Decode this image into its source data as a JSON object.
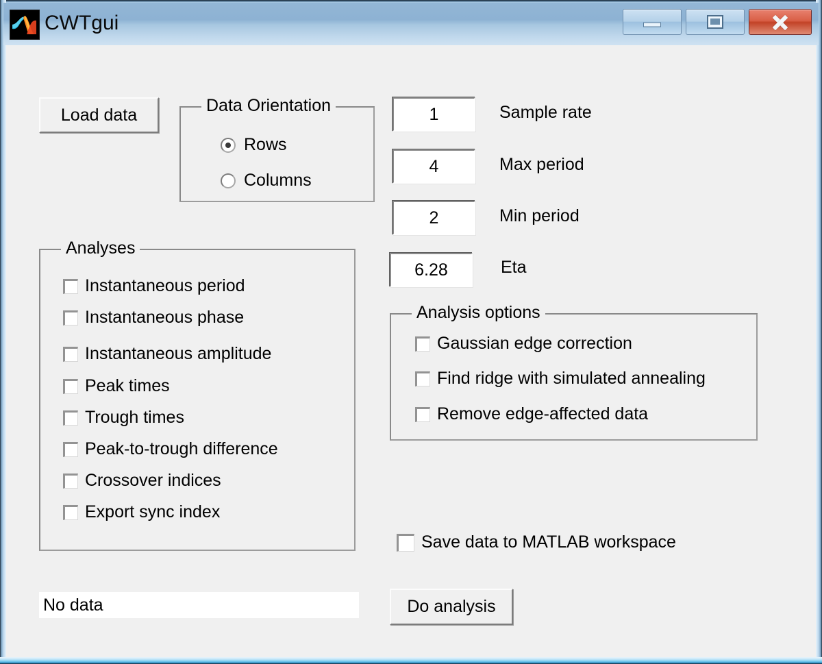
{
  "window": {
    "title": "CWTgui",
    "icon": "matlab-logo-icon",
    "controls": {
      "minimize": "minimize-icon",
      "maximize": "restore-icon",
      "close": "close-icon"
    }
  },
  "toolbar": {
    "load_data_label": "Load data"
  },
  "data_orientation": {
    "title": "Data Orientation",
    "options": [
      {
        "label": "Rows",
        "selected": true
      },
      {
        "label": "Columns",
        "selected": false
      }
    ]
  },
  "parameters": [
    {
      "value": "1",
      "label": "Sample rate"
    },
    {
      "value": "4",
      "label": "Max period"
    },
    {
      "value": "2",
      "label": "Min period"
    },
    {
      "value": "6.28",
      "label": "Eta"
    }
  ],
  "analyses": {
    "title": "Analyses",
    "items": [
      {
        "label": "Instantaneous period",
        "checked": false
      },
      {
        "label": "Instantaneous phase",
        "checked": false
      },
      {
        "label": "Instantaneous amplitude",
        "checked": false
      },
      {
        "label": "Peak times",
        "checked": false
      },
      {
        "label": "Trough times",
        "checked": false
      },
      {
        "label": "Peak-to-trough difference",
        "checked": false
      },
      {
        "label": "Crossover indices",
        "checked": false
      },
      {
        "label": "Export sync index",
        "checked": false
      }
    ]
  },
  "analysis_options": {
    "title": "Analysis options",
    "items": [
      {
        "label": "Gaussian edge correction",
        "checked": false
      },
      {
        "label": "Find ridge with simulated annealing",
        "checked": false
      },
      {
        "label": "Remove edge-affected data",
        "checked": false
      }
    ]
  },
  "save_option": {
    "label": "Save data to MATLAB workspace",
    "checked": false
  },
  "status": {
    "text": "No data"
  },
  "actions": {
    "do_analysis_label": "Do analysis"
  },
  "colors": {
    "window_bg": "#f0f0f0",
    "titlebar_top": "#93b6d6",
    "titlebar_bottom": "#cfe2f2",
    "close_button": "#c24227",
    "field_bg": "#ffffff",
    "text": "#000000"
  }
}
